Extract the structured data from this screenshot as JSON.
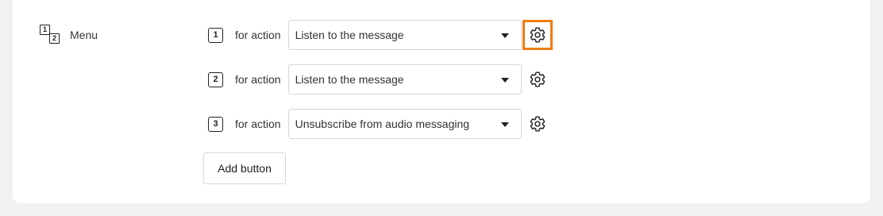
{
  "menu": {
    "label": "Menu",
    "icon": "numbered-menu-icon",
    "icon_digits": [
      "1",
      "2"
    ]
  },
  "rows": [
    {
      "number": "1",
      "for_action_label": "for action",
      "selected_action": "Listen to the message",
      "settings_icon": "gear-icon",
      "settings_focused": true
    },
    {
      "number": "2",
      "for_action_label": "for action",
      "selected_action": "Listen to the message",
      "settings_icon": "gear-icon",
      "settings_focused": false
    },
    {
      "number": "3",
      "for_action_label": "for action",
      "selected_action": "Unsubscribe from audio messaging",
      "settings_icon": "gear-icon",
      "settings_focused": false
    }
  ],
  "add_button": {
    "label": "Add button"
  },
  "colors": {
    "focus_outline": "#f07c12",
    "page_background": "#f0f2f1",
    "card_background": "#ffffff"
  }
}
